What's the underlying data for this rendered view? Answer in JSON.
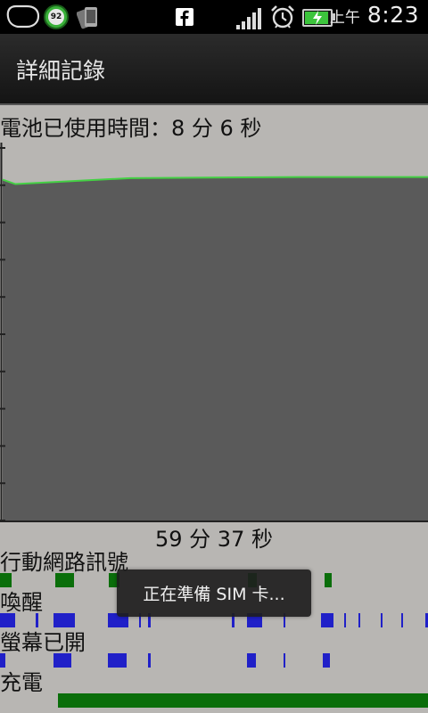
{
  "statusbar": {
    "battery_percent": "92",
    "ampm": "上午",
    "time": "8:23",
    "icons": [
      "chat-bubble-icon",
      "battery-ring-icon",
      "screenshot-icon",
      "facebook-icon",
      "signal-bars-icon",
      "alarm-clock-icon",
      "battery-charging-icon"
    ],
    "battery_level": 0.92
  },
  "header": {
    "title": "詳細記錄"
  },
  "content": {
    "used_label": "電池已使用時間：8 分 6 秒",
    "graph_total": "59 分 37 秒"
  },
  "tracks": [
    {
      "label": "行動網路訊號",
      "color": "#0a6e0a"
    },
    {
      "label": "喚醒",
      "color": "#2020c8"
    },
    {
      "label": "螢幕已開",
      "color": "#2020c8"
    },
    {
      "label": "充電",
      "color": "#0a6e0a"
    }
  ],
  "toast": {
    "text": "正在準備 SIM 卡..."
  },
  "colors": {
    "graph_fill": "#5a5a5a",
    "graph_line": "#44d044",
    "background": "#b8b6b3",
    "tick": "#222222"
  },
  "chart_data": {
    "type": "area",
    "title": "電池已使用時間：8 分 6 秒",
    "xlabel": "59 分 37 秒",
    "ylabel": "",
    "ylim": [
      0,
      100
    ],
    "x": [
      0,
      0.03,
      0.3,
      0.7,
      1.0
    ],
    "series": [
      {
        "values": [
          91.5,
          90.3,
          91.9,
          92.2,
          92.2
        ]
      }
    ]
  }
}
